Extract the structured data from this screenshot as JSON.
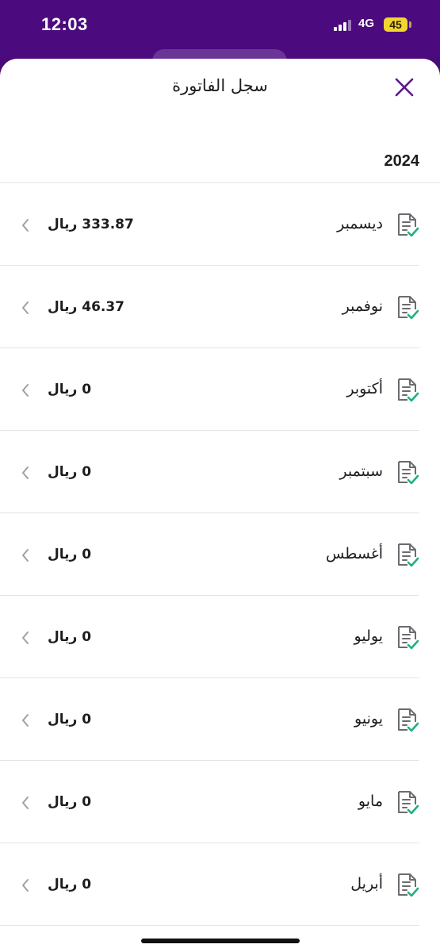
{
  "status_bar": {
    "time": "12:03",
    "network": "4G",
    "battery": "45"
  },
  "sheet": {
    "title": "سجل الفاتورة",
    "close_icon": "close-x-icon"
  },
  "year": "2024",
  "colors": {
    "accent": "#4b0a7d",
    "check": "#22b07d",
    "close": "#5a1a8c"
  },
  "invoices": [
    {
      "month": "ديسمبر",
      "amount": "333.87 ريال"
    },
    {
      "month": "نوفمبر",
      "amount": "46.37 ريال"
    },
    {
      "month": "أكتوبر",
      "amount": "0 ريال"
    },
    {
      "month": "سبتمبر",
      "amount": "0 ريال"
    },
    {
      "month": "أغسطس",
      "amount": "0 ريال"
    },
    {
      "month": "يوليو",
      "amount": "0 ريال"
    },
    {
      "month": "يونيو",
      "amount": "0 ريال"
    },
    {
      "month": "مايو",
      "amount": "0 ريال"
    },
    {
      "month": "أبريل",
      "amount": "0 ريال"
    }
  ]
}
